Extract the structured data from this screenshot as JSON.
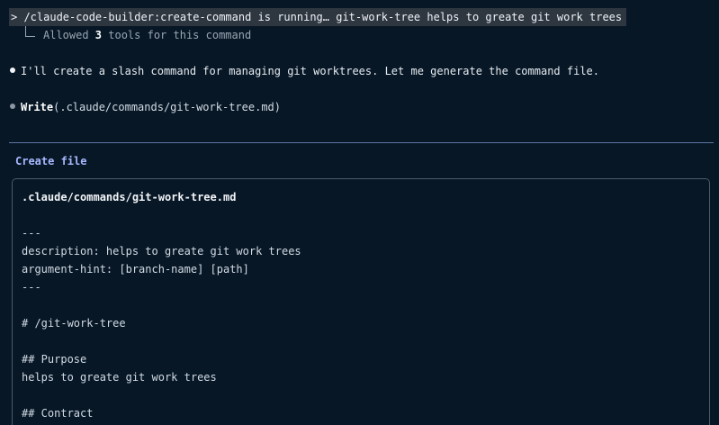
{
  "terminal": {
    "command_line": "> /claude-code-builder:create-command is running… git-work-tree helps to greate git work trees",
    "tools_prefix": "Allowed ",
    "tools_count": "3",
    "tools_suffix": " tools for this command",
    "assistant_message": "I'll create a slash command for managing git worktrees. Let me generate the command file.",
    "tool_call_name": "Write",
    "tool_call_args": "(.claude/commands/git-work-tree.md)"
  },
  "create_file": {
    "title": "Create file",
    "filename": ".claude/commands/git-work-tree.md",
    "lines": [
      "---",
      "description: helps to greate git work trees",
      "argument-hint: [branch-name] [path]",
      "---",
      "# /git-work-tree",
      "## Purpose",
      "helps to greate git work trees",
      "## Contract"
    ]
  },
  "colors": {
    "background": "#071726",
    "prompt_highlight": "#2e3640",
    "title_accent": "#a8b8ff",
    "divider": "#5b74a3"
  }
}
